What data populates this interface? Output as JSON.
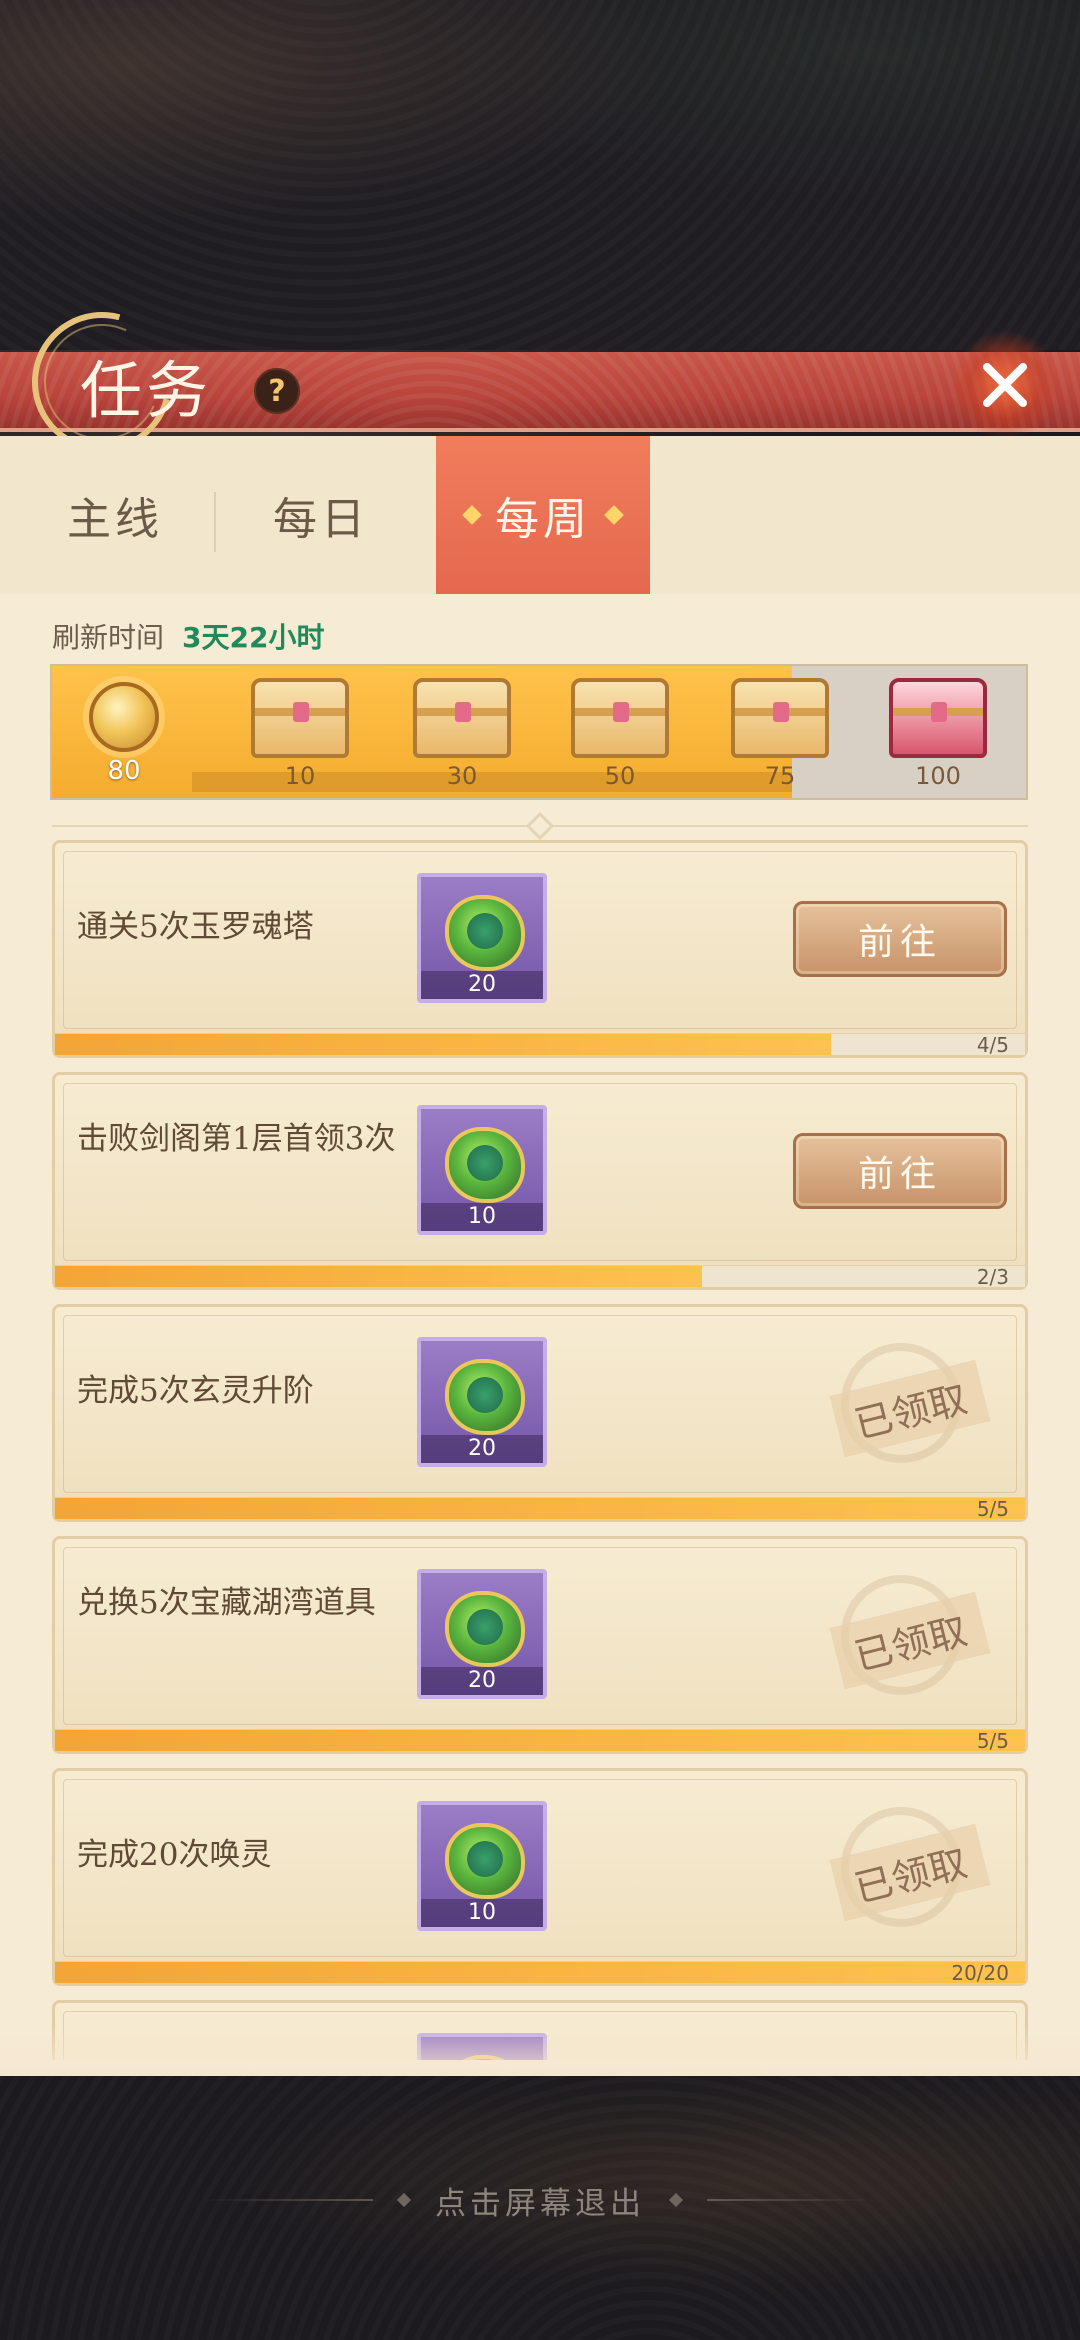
{
  "header": {
    "title": "任务",
    "help_icon": "?"
  },
  "tabs": [
    {
      "label": "主线",
      "selected": false
    },
    {
      "label": "每日",
      "selected": false
    },
    {
      "label": "每周",
      "selected": true
    }
  ],
  "refresh": {
    "label": "刷新时间",
    "value": "3天22小时"
  },
  "reward_track": {
    "current_points": "80",
    "progress_fraction": 0.76,
    "milestones": [
      {
        "value": "10",
        "reached": true
      },
      {
        "value": "30",
        "reached": true
      },
      {
        "value": "50",
        "reached": true
      },
      {
        "value": "75",
        "reached": true
      },
      {
        "value": "100",
        "reached": false
      }
    ]
  },
  "tasks": [
    {
      "name": "通关5次玉罗魂塔",
      "reward_count": "20",
      "status": "go",
      "action_label": "前往",
      "progress": "4/5",
      "fraction": 0.8
    },
    {
      "name": "击败剑阁第1层首领3次",
      "reward_count": "10",
      "status": "go",
      "action_label": "前往",
      "progress": "2/3",
      "fraction": 0.667
    },
    {
      "name": "完成5次玄灵升阶",
      "reward_count": "20",
      "status": "claimed",
      "action_label": "已领取",
      "progress": "5/5",
      "fraction": 1
    },
    {
      "name": "兑换5次宝藏湖湾道具",
      "reward_count": "20",
      "status": "claimed",
      "action_label": "已领取",
      "progress": "5/5",
      "fraction": 1
    },
    {
      "name": "完成20次唤灵",
      "reward_count": "10",
      "status": "claimed",
      "action_label": "已领取",
      "progress": "20/20",
      "fraction": 1
    }
  ],
  "footer": {
    "exit_hint": "点击屏幕退出"
  },
  "colors": {
    "accent": "#e5684e",
    "progress": "#f4ac2e",
    "refresh_value": "#1f8a5a"
  },
  "icons": {
    "close": "close-icon",
    "reward_item": "spirit-orb-icon",
    "chest": "treasure-chest-icon",
    "points": "coin-icon"
  }
}
